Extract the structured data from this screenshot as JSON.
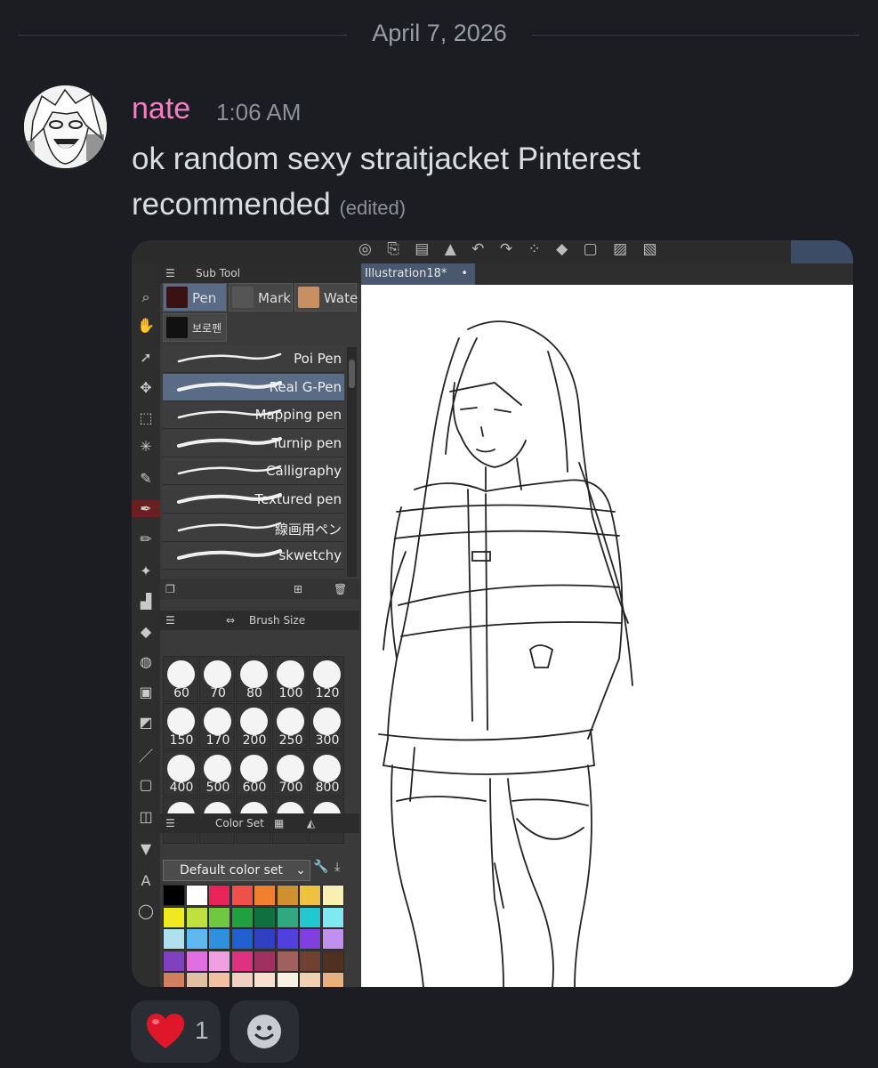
{
  "date_divider": "April 7, 2026",
  "message": {
    "username": "nate",
    "timestamp": "1:06 AM",
    "text": "ok random sexy straitjacket Pinterest recommended",
    "edited_label": "(edited)",
    "username_color": "#f47fc4"
  },
  "attachment": {
    "app": {
      "subtool_title": "Sub Tool",
      "tabs": [
        "Pen",
        "Mark",
        "Wate",
        "보로펜"
      ],
      "brushes": [
        "Poi Pen",
        "Real G-Pen",
        "Mapping pen",
        "Turnip pen",
        "Calligraphy",
        "Textured pen",
        "線画用ペン",
        "skwetchy"
      ],
      "selected_brush": "Real G-Pen",
      "brush_size_title": "Brush Size",
      "brush_sizes": [
        "60",
        "70",
        "80",
        "100",
        "120",
        "150",
        "170",
        "200",
        "250",
        "300",
        "400",
        "500",
        "600",
        "700",
        "800",
        "",
        "",
        "",
        "",
        ""
      ],
      "color_set_title": "Color Set",
      "color_set_value": "Default color set",
      "document_tab": "Illustration18*",
      "palette": [
        "#000000",
        "#ffffff",
        "#e8245a",
        "#f0504a",
        "#f08030",
        "#d09030",
        "#f0c040",
        "#f8f0b0",
        "#f0e820",
        "#c0e040",
        "#70c840",
        "#20a040",
        "#107040",
        "#30a880",
        "#20c8d0",
        "#80e8f0",
        "#b0e0f0",
        "#60b8f0",
        "#3090e0",
        "#2060d0",
        "#3040c0",
        "#5040e0",
        "#8040e0",
        "#c090f0",
        "#8040c0",
        "#e070e0",
        "#f0a0e0",
        "#e03080",
        "#a03060",
        "#a06060",
        "#704030",
        "#503020",
        "#d08060",
        "#e0c0a0",
        "#f0c0a0",
        "#f0d0c0",
        "#f8e0d0",
        "#f8f0e0",
        "#f0d0b0",
        "#e8b080",
        "#d09080",
        "#e08070",
        "#e0a090",
        "#f0b0a0",
        "#e8c0c0",
        "#d0a0a0",
        "#b0a0c0",
        "#a0a0a0"
      ]
    }
  },
  "reactions": [
    {
      "emoji": "heart-icon",
      "count": "1"
    }
  ],
  "add_reaction_icon": "smile-icon"
}
